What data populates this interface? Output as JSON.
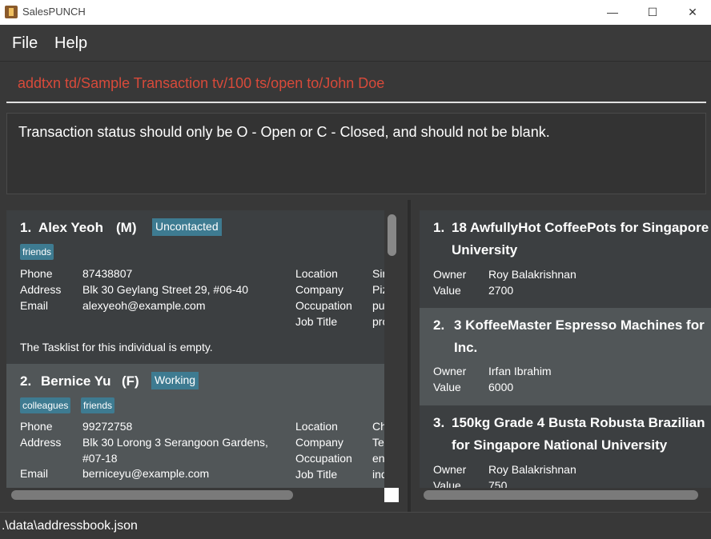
{
  "window": {
    "title": "SalesPUNCH",
    "minimize_symbol": "—",
    "maximize_symbol": "☐",
    "close_symbol": "✕"
  },
  "menu": {
    "file": "File",
    "help": "Help"
  },
  "command": {
    "value": "addtxn td/Sample Transaction tv/100 ts/open to/John Doe"
  },
  "result": {
    "message": "Transaction status should only be O - Open or C - Closed, and should not be blank."
  },
  "contacts": [
    {
      "index": "1.",
      "name": "Alex Yeoh",
      "gender": "(M)",
      "status": "Uncontacted",
      "tags": [
        "friends"
      ],
      "phone_label": "Phone",
      "phone": "87438807",
      "address_label": "Address",
      "address": "Blk 30 Geylang Street 29, #06-40",
      "address2": "",
      "email_label": "Email",
      "email": "alexyeoh@example.com",
      "location_label": "Location",
      "location": "Sin",
      "company_label": "Company",
      "company": "Piz",
      "occupation_label": "Occupation",
      "occupation": "pu",
      "jobtitle_label": "Job Title",
      "jobtitle": "pro",
      "tasklist": "The Tasklist for this individual is empty."
    },
    {
      "index": "2.",
      "name": "Bernice Yu",
      "gender": "(F)",
      "status": "Working",
      "tags": [
        "colleagues",
        "friends"
      ],
      "phone_label": "Phone",
      "phone": "99272758",
      "address_label": "Address",
      "address": "Blk 30 Lorong 3 Serangoon Gardens,",
      "address2": "#07-18",
      "email_label": "Email",
      "email": "berniceyu@example.com",
      "location_label": "Location",
      "location": "Ch",
      "company_label": "Company",
      "company": "Te",
      "occupation_label": "Occupation",
      "occupation": "en",
      "jobtitle_label": "Job Title",
      "jobtitle": "ind"
    }
  ],
  "transactions": [
    {
      "index": "1.",
      "title1": "18 AwfullyHot CoffeePots for Singapore",
      "title2": "University",
      "owner_label": "Owner",
      "owner": "Roy Balakrishnan",
      "value_label": "Value",
      "value": "2700"
    },
    {
      "index": "2.",
      "title1": "3 KoffeeMaster Espresso Machines for",
      "title2": "Inc.",
      "owner_label": "Owner",
      "owner": "Irfan Ibrahim",
      "value_label": "Value",
      "value": "6000"
    },
    {
      "index": "3.",
      "title1": "150kg Grade 4 Busta Robusta Brazilian",
      "title2": "for Singapore National University",
      "owner_label": "Owner",
      "owner": "Roy Balakrishnan",
      "value_label": "Value",
      "value": "750"
    }
  ],
  "statusbar": {
    "path": ".\\data\\addressbook.json"
  }
}
